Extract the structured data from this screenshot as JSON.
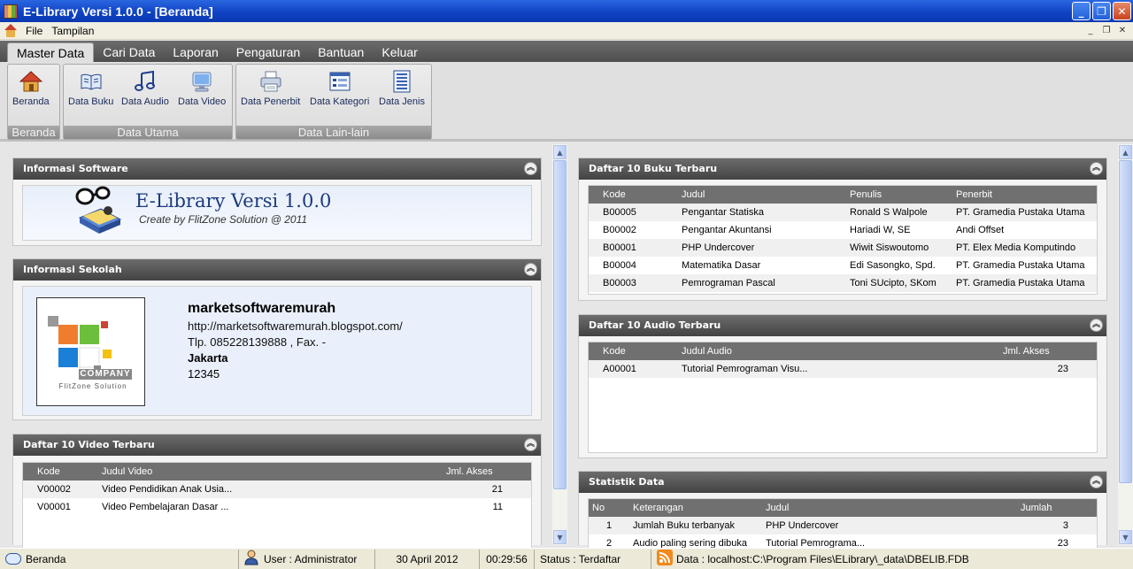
{
  "window": {
    "title": "E-Library Versi 1.0.0 - [Beranda]"
  },
  "menu": {
    "items": [
      "File",
      "Tampilan"
    ]
  },
  "ribbon": {
    "tabs": [
      "Master Data",
      "Cari Data",
      "Laporan",
      "Pengaturan",
      "Bantuan",
      "Keluar"
    ],
    "active_tab": "Master Data",
    "groups": [
      {
        "caption": "Beranda",
        "buttons": [
          "Beranda"
        ]
      },
      {
        "caption": "Data Utama",
        "buttons": [
          "Data Buku",
          "Data Audio",
          "Data Video"
        ]
      },
      {
        "caption": "Data Lain-lain",
        "buttons": [
          "Data Penerbit",
          "Data Kategori",
          "Data Jenis"
        ]
      }
    ]
  },
  "software": {
    "heading": "Informasi Software",
    "product": "E-Library Versi 1.0.0",
    "credit": "Create by FlitZone Solution @ 2011"
  },
  "school": {
    "heading": "Informasi Sekolah",
    "name": "marketsoftwaremurah",
    "website": "http://marketsoftwaremurah.blogspot.com/",
    "phone": "Tlp. 085228139888 , Fax. -",
    "city": "Jakarta",
    "postal": "12345",
    "logo_text": "COMPANY",
    "logo_subtext": "FlitZone Solution"
  },
  "videos": {
    "heading": "Daftar 10 Video Terbaru",
    "columns": [
      "Kode",
      "Judul Video",
      "Jml. Akses"
    ],
    "rows": [
      [
        "V00002",
        "Video Pendidikan Anak Usia...",
        "21"
      ],
      [
        "V00001",
        "Video Pembelajaran Dasar ...",
        "11"
      ]
    ]
  },
  "books": {
    "heading": "Daftar 10 Buku Terbaru",
    "columns": [
      "Kode",
      "Judul",
      "Penulis",
      "Penerbit"
    ],
    "rows": [
      [
        "B00005",
        "Pengantar Statiska",
        "Ronald S Walpole",
        "PT. Gramedia Pustaka Utama"
      ],
      [
        "B00002",
        "Pengantar Akuntansi",
        "Hariadi W, SE",
        "Andi Offset"
      ],
      [
        "B00001",
        "PHP Undercover",
        "Wiwit Siswoutomo",
        "PT. Elex Media Komputindo"
      ],
      [
        "B00004",
        "Matematika Dasar",
        "Edi Sasongko, Spd.",
        "PT. Gramedia Pustaka Utama"
      ],
      [
        "B00003",
        "Pemrograman Pascal",
        "Toni SUcipto, SKom",
        "PT. Gramedia Pustaka Utama"
      ]
    ]
  },
  "audio": {
    "heading": "Daftar 10 Audio Terbaru",
    "columns": [
      "Kode",
      "Judul Audio",
      "Jml. Akses"
    ],
    "rows": [
      [
        "A00001",
        "Tutorial Pemrograman Visu...",
        "23"
      ]
    ]
  },
  "stats": {
    "heading": "Statistik Data",
    "columns": [
      "No",
      "Keterangan",
      "Judul",
      "Jumlah"
    ],
    "rows": [
      [
        "1",
        "Jumlah Buku terbanyak",
        "PHP Undercover",
        "3"
      ],
      [
        "2",
        "Audio paling sering dibuka",
        "Tutorial Pemrograma...",
        "23"
      ]
    ]
  },
  "status": {
    "page": "Beranda",
    "user": "User : Administrator",
    "date": "30 April 2012",
    "time": "00:29:56",
    "reg": "Status : Terdaftar",
    "db": "Data : localhost:C:\\Program Files\\ELibrary\\_data\\DBELIB.FDB"
  }
}
